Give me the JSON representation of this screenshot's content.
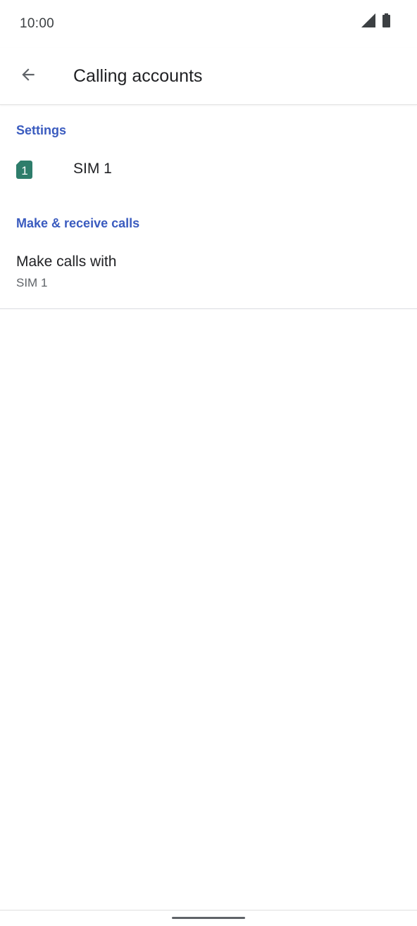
{
  "status_bar": {
    "time": "10:00",
    "icons": [
      "signal-icon",
      "battery-icon"
    ]
  },
  "app_bar": {
    "back_icon": "arrow-back-icon",
    "title": "Calling accounts"
  },
  "sections": {
    "settings": {
      "header": "Settings",
      "sim_item": {
        "icon": "sim-card-icon",
        "icon_number": "1",
        "icon_color": "#2e7d6b",
        "label": "SIM 1"
      }
    },
    "make_receive": {
      "header": "Make & receive calls",
      "make_calls_with": {
        "title": "Make calls with",
        "summary": "SIM 1"
      }
    }
  },
  "colors": {
    "accent": "#3a5bbf",
    "primary_text": "#202124",
    "secondary_text": "#5f6368"
  }
}
